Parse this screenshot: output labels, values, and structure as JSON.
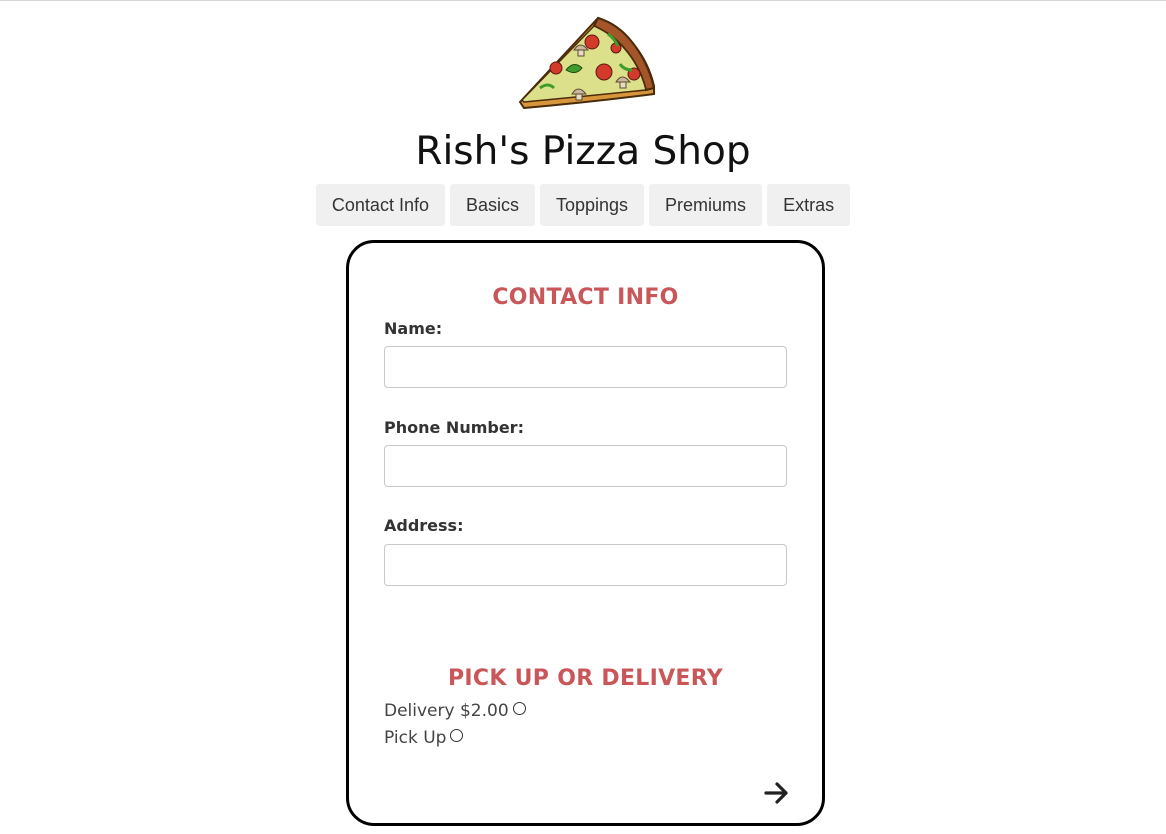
{
  "header": {
    "logo_icon": "pizza-slice-icon",
    "title": "Rish's Pizza Shop"
  },
  "tabs": [
    {
      "label": "Contact Info"
    },
    {
      "label": "Basics"
    },
    {
      "label": "Toppings"
    },
    {
      "label": "Premiums"
    },
    {
      "label": "Extras"
    }
  ],
  "contact": {
    "heading": "CONTACT INFO",
    "name_label": "Name:",
    "name_value": "",
    "phone_label": "Phone Number:",
    "phone_value": "",
    "address_label": "Address:",
    "address_value": ""
  },
  "delivery": {
    "heading": "PICK UP OR DELIVERY",
    "options": [
      {
        "label": "Delivery $2.00",
        "selected": false
      },
      {
        "label": "Pick Up",
        "selected": false
      }
    ]
  },
  "navigation": {
    "next_icon": "arrow-right-icon"
  },
  "colors": {
    "accent": "#c9575a",
    "tab_bg": "#f0f0f0",
    "card_border": "#000000"
  }
}
